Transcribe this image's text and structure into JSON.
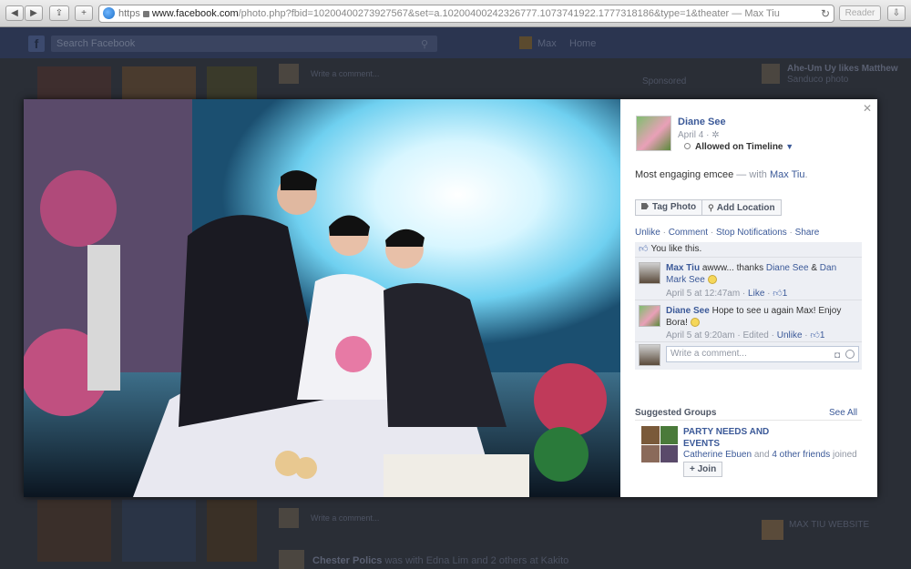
{
  "browser": {
    "back_icon": "back-arrow",
    "forward_icon": "forward-arrow",
    "share_icon": "share-box",
    "add_icon": "plus",
    "url_scheme": "https",
    "url_domain": "www.facebook.com",
    "url_rest": "/photo.php?fbid=10200400273927567&set=a.10200400242326777.1073741922.1777318186&type=1&theater",
    "page_title": " — Max Tiu",
    "reader_label": "Reader"
  },
  "facebook": {
    "search_placeholder": "Search Facebook",
    "nav_profile": "Max",
    "nav_home": "Home",
    "bg": {
      "feed_left": "Write a comment...",
      "sponsored": "Sponsored",
      "ticker_1": "Ahe-Um Uy likes Matthew",
      "ticker_1b": "Sanduco photo",
      "max_tiu_site": "MAX TIU WEBSITE",
      "story_name": "Chester Polics",
      "story_text": " was with Edna Lim and 2 others at Kakito"
    }
  },
  "viewer": {
    "close_icon": "close-x",
    "poster_name": "Diane See",
    "post_date": "April 4 · ",
    "privacy_icon": "gear",
    "timeline_status": "Allowed on Timeline",
    "caption_text": "Most engaging emcee",
    "caption_with": " — with ",
    "caption_tag": "Max Tiu",
    "caption_end": ".",
    "tag_photo_label": "Tag Photo",
    "add_location_label": "Add Location",
    "actions": {
      "unlike": "Unlike",
      "comment": "Comment",
      "stop_notifications": "Stop Notifications",
      "share": "Share"
    },
    "likes_text": "You like this.",
    "comments": [
      {
        "author": "Max Tiu",
        "text_pre": " awww... thanks ",
        "mention_1": "Diane See",
        "text_mid": " & ",
        "mention_2": "Dan Mark See",
        "meta_time": "April 5 at 12:47am · ",
        "meta_like": "Like",
        "meta_sep": " · ",
        "like_count": "1"
      },
      {
        "author": "Diane See",
        "text": " Hope to see u again Max! Enjoy Bora! ",
        "meta_time": "April 5 at 9:20am · Edited · ",
        "meta_like": "Unlike",
        "meta_sep": " · ",
        "like_count": "1"
      }
    ],
    "write_comment_placeholder": "Write a comment...",
    "suggested_groups_title": "Suggested Groups",
    "see_all_label": "See All",
    "group_name": "PARTY NEEDS AND EVENTS",
    "group_member": "Catherine Ebuen",
    "group_joined_text": " and ",
    "group_friends": "4 other friends",
    "group_joined_tail": " joined",
    "join_label": "+ Join"
  },
  "colors": {
    "fb_blue": "#3b5998",
    "meta_grey": "#9197a3",
    "ufi_bg": "#edeff4"
  }
}
